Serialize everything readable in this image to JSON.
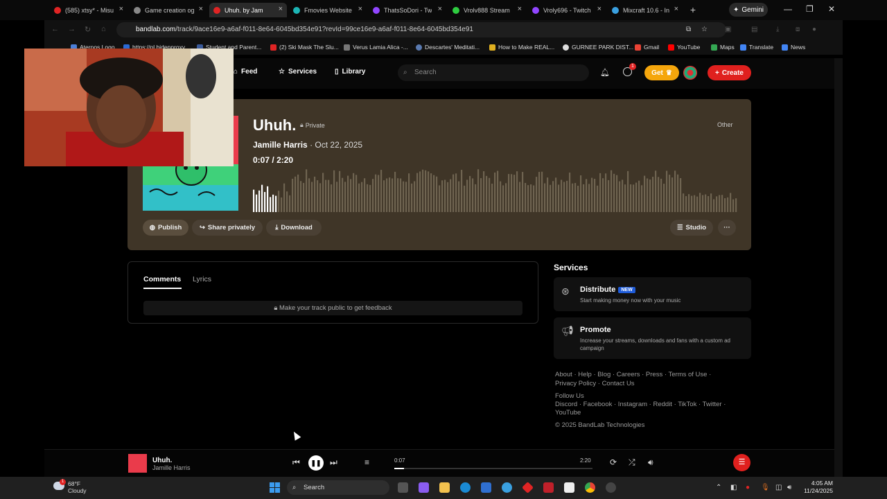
{
  "browser": {
    "tabs": [
      {
        "label": "(585) xtsy* - Misu",
        "color": "#e02424"
      },
      {
        "label": "Game creation og",
        "color": "#888888"
      },
      {
        "label": "Uhuh. by Jam",
        "color": "#e02424"
      },
      {
        "label": "Fmovies Website",
        "color": "#1cb5b5"
      },
      {
        "label": "ThatsSoDori - Tw",
        "color": "#9146ff"
      },
      {
        "label": "Vrolv888 Stream",
        "color": "#2ecc40"
      },
      {
        "label": "Vroly696 - Twitch",
        "color": "#9146ff"
      },
      {
        "label": "Mixcraft 10.6 - In",
        "color": "#3aa0e0"
      }
    ],
    "gemini_label": "Gemini",
    "url_domain": "bandlab.com",
    "url_path": "/track/9ace16e9-a6af-f011-8e64-6045bd354e91?revId=99ce16e9-a6af-f011-8e64-6045bd354e91",
    "bookmarks": [
      "Aternos Logo",
      "https://pl.bidenproxy",
      "Student and Parent...",
      "(2) Ski Mask The Slu...",
      "Verus Lamia Alica -...",
      "Descartes' Meditati...",
      "How to Make REAL...",
      "GURNEE PARK DIST...",
      "Gmail",
      "YouTube",
      "Maps",
      "Translate",
      "News"
    ]
  },
  "nav": {
    "feed": "Feed",
    "services": "Services",
    "library": "Library",
    "search_placeholder": "Search",
    "notif_count": "1",
    "get_label": "Get",
    "create_label": "Create"
  },
  "track": {
    "title": "Uhuh.",
    "visibility": "Private",
    "genre": "Other",
    "artist": "Jamille Harris",
    "date": "· Oct 22, 2025",
    "elapsed": "0:07",
    "separator": "/",
    "duration": "2:20",
    "progress_fraction": 0.05,
    "buttons": {
      "publish": "Publish",
      "share": "Share privately",
      "download": "Download",
      "studio": "Studio"
    }
  },
  "comments": {
    "tab_comments": "Comments",
    "tab_lyrics": "Lyrics",
    "notice": "Make your track public to get feedback"
  },
  "services": {
    "heading": "Services",
    "distribute_name": "Distribute",
    "distribute_tag": "NEW",
    "distribute_desc": "Start making money now with your music",
    "promote_name": "Promote",
    "promote_desc": "Increase your streams, downloads and fans with a custom ad campaign"
  },
  "footer": {
    "line1": "About · Help · Blog · Careers · Press · Terms of Use ·",
    "line2": "Privacy Policy · Contact Us",
    "follow": "Follow Us",
    "social1": "Discord · Facebook · Instagram · Reddit · TikTok · Twitter ·",
    "social2": "YouTube",
    "copyright": "© 2025 BandLab Technologies"
  },
  "player": {
    "title": "Uhuh.",
    "artist": "Jamille Harris",
    "elapsed": "0:07",
    "duration": "2:20"
  },
  "taskbar": {
    "temp": "68°F",
    "condition": "Cloudy",
    "weather_badge": "1",
    "search_label": "Search",
    "time": "4:05 AM",
    "date": "11/24/2025"
  }
}
